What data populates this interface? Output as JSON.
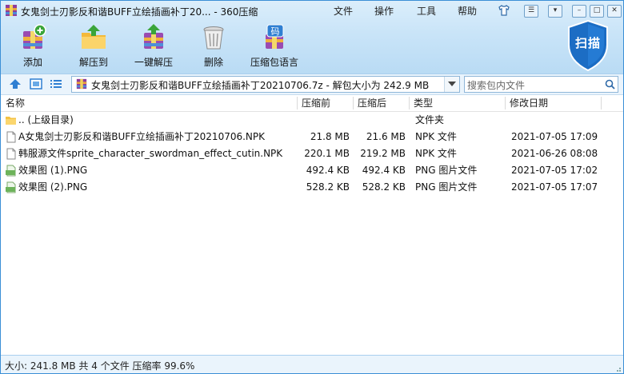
{
  "window": {
    "title": "女鬼剑士刃影反和谐BUFF立绘插画补丁20... - 360压缩",
    "menu": [
      "文件",
      "操作",
      "工具",
      "帮助"
    ]
  },
  "toolbar": [
    {
      "label": "添加",
      "icon": "add-books-icon"
    },
    {
      "label": "解压到",
      "icon": "extract-folder-icon"
    },
    {
      "label": "一键解压",
      "icon": "quick-extract-icon"
    },
    {
      "label": "删除",
      "icon": "trash-can-icon"
    },
    {
      "label": "压缩包语言",
      "icon": "archive-language-icon"
    }
  ],
  "scan_button": {
    "label": "扫描"
  },
  "address": {
    "path": "女鬼剑士刃影反和谐BUFF立绘插画补丁20210706.7z - 解包大小为 242.9 MB",
    "search_placeholder": "搜索包内文件"
  },
  "columns": [
    "名称",
    "压缩前",
    "压缩后",
    "类型",
    "修改日期"
  ],
  "rows": [
    {
      "icon": "folder",
      "name": ".. (上级目录)",
      "size": "",
      "packed": "",
      "type": "文件夹",
      "date": ""
    },
    {
      "icon": "file",
      "name": "A女鬼剑士刃影反和谐BUFF立绘插画补丁20210706.NPK",
      "size": "21.8 MB",
      "packed": "21.6 MB",
      "type": "NPK 文件",
      "date": "2021-07-05 17:09"
    },
    {
      "icon": "file",
      "name": "韩服源文件sprite_character_swordman_effect_cutin.NPK",
      "size": "220.1 MB",
      "packed": "219.2 MB",
      "type": "NPK 文件",
      "date": "2021-06-26 08:08"
    },
    {
      "icon": "png",
      "name": "效果图 (1).PNG",
      "size": "492.4 KB",
      "packed": "492.4 KB",
      "type": "PNG 图片文件",
      "date": "2021-07-05 17:02"
    },
    {
      "icon": "png",
      "name": "效果图 (2).PNG",
      "size": "528.2 KB",
      "packed": "528.2 KB",
      "type": "PNG 图片文件",
      "date": "2021-07-05 17:07"
    }
  ],
  "status": {
    "text": "大小: 241.8 MB 共 4 个文件 压缩率 99.6%"
  },
  "colors": {
    "accent": "#3b8fd6",
    "toolbar_bg": "#c9e4f8",
    "folder": "#f5c242"
  }
}
